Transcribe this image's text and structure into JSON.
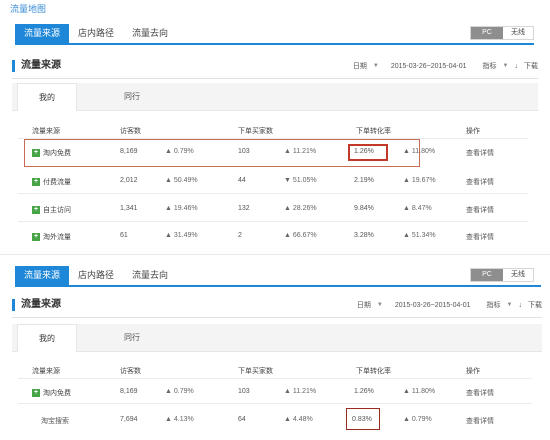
{
  "page_title": "流量地图",
  "tabs": [
    "流量来源",
    "店内路径",
    "流量去向"
  ],
  "toggle": {
    "on_label": "PC",
    "off_label": "无线"
  },
  "section": {
    "title": "流量来源",
    "date_label": "日期",
    "date_range": "2015-03-26~2015-04-01",
    "metric_label": "指标",
    "download_label": "下载"
  },
  "subtabs": [
    "我的",
    "同行"
  ],
  "columns": [
    "流量来源",
    "访客数",
    "下单买家数",
    "下单转化率",
    "操作"
  ],
  "rows_top": [
    {
      "source": "淘内免费",
      "visitors": "8,169",
      "visitors_trend": "▲ 0.79%",
      "buyers": "103",
      "buyers_trend": "▲ 11.21%",
      "conversion": "1.26%",
      "conversion_trend": "▲ 11.80%",
      "action": "查看详情"
    },
    {
      "source": "付费流量",
      "visitors": "2,012",
      "visitors_trend": "▲ 50.49%",
      "buyers": "44",
      "buyers_trend": "▼ 51.05%",
      "conversion": "2.19%",
      "conversion_trend": "▲ 19.67%",
      "action": "查看详情"
    },
    {
      "source": "自主访问",
      "visitors": "1,341",
      "visitors_trend": "▲ 19.46%",
      "buyers": "132",
      "buyers_trend": "▲ 28.26%",
      "conversion": "9.84%",
      "conversion_trend": "▲ 8.47%",
      "action": "查看详情"
    },
    {
      "source": "淘外流量",
      "visitors": "61",
      "visitors_trend": "▲ 31.49%",
      "buyers": "2",
      "buyers_trend": "▲ 66.67%",
      "conversion": "3.28%",
      "conversion_trend": "▲ 51.34%",
      "action": "查看详情"
    }
  ],
  "rows_bottom": [
    {
      "source": "淘内免费",
      "visitors": "8,169",
      "visitors_trend": "▲ 0.79%",
      "buyers": "103",
      "buyers_trend": "▲ 11.21%",
      "conversion": "1.26%",
      "conversion_trend": "▲ 11.80%",
      "action": "查看详情"
    },
    {
      "source": "淘宝搜索",
      "visitors": "7,694",
      "visitors_trend": "▲ 4.13%",
      "buyers": "64",
      "buyers_trend": "▲ 4.48%",
      "conversion": "0.83%",
      "conversion_trend": "▲ 0.79%",
      "action": "查看详情"
    }
  ],
  "icons": {
    "expand": "plus-icon",
    "caret": "caret-down-icon"
  },
  "colors": {
    "accent": "#1f87d8",
    "highlight": "#c0392b",
    "plus": "#47a447"
  }
}
